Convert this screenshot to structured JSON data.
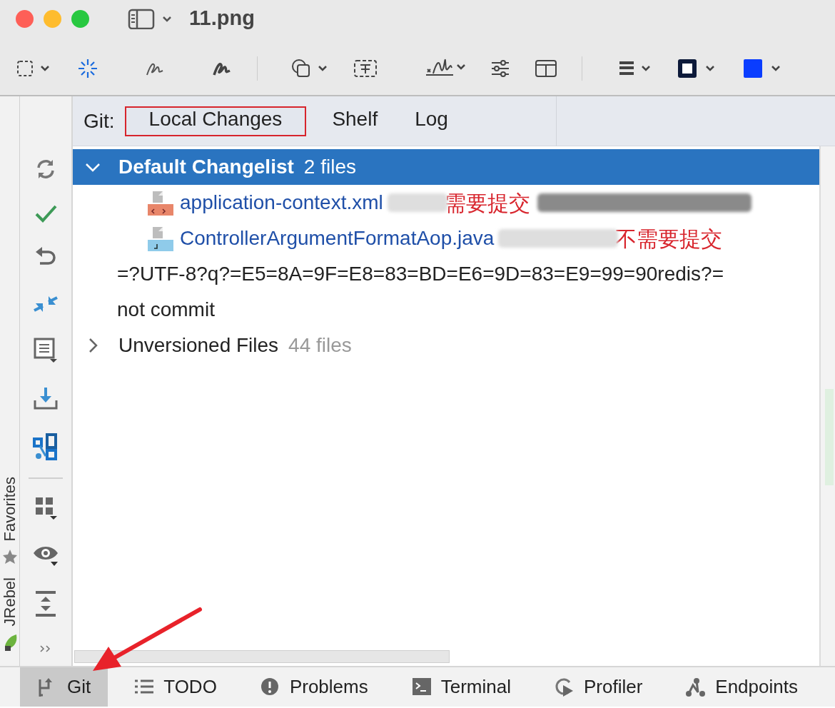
{
  "window": {
    "title": "11.png"
  },
  "side_strip": [
    {
      "label": "Favorites",
      "kind": "star"
    },
    {
      "label": "JRebel",
      "kind": "rocket"
    }
  ],
  "git_header": {
    "label": "Git:",
    "tabs": [
      {
        "label": "Local Changes",
        "selected": true
      },
      {
        "label": "Shelf",
        "selected": false
      },
      {
        "label": "Log",
        "selected": false
      }
    ]
  },
  "tree": [
    {
      "kind": "group",
      "label": "Default Changelist",
      "count": "2 files",
      "expanded": true,
      "selected": true,
      "children": [
        {
          "kind": "xml_file",
          "name": "application-context.xml",
          "note": "需要提交"
        },
        {
          "kind": "java_file",
          "name": "ControllerArgumentFormatAop.java",
          "note": "不需要提交"
        }
      ]
    },
    {
      "kind": "text",
      "label": "=?UTF-8?q?=E5=8A=9F=E8=83=BD=E6=9D=83=E9=99=90redis?="
    },
    {
      "kind": "text",
      "label": "not commit"
    },
    {
      "kind": "group",
      "label": "Unversioned Files",
      "count": "44 files",
      "expanded": false,
      "selected": false
    }
  ],
  "bottom_tabs": [
    {
      "label": "Git",
      "kind": "git",
      "selected": true
    },
    {
      "label": "TODO",
      "kind": "list",
      "selected": false
    },
    {
      "label": "Problems",
      "kind": "problems",
      "selected": false
    },
    {
      "label": "Terminal",
      "kind": "terminal",
      "selected": false
    },
    {
      "label": "Profiler",
      "kind": "profiler",
      "selected": false
    },
    {
      "label": "Endpoints",
      "kind": "endpoints",
      "selected": false
    }
  ]
}
